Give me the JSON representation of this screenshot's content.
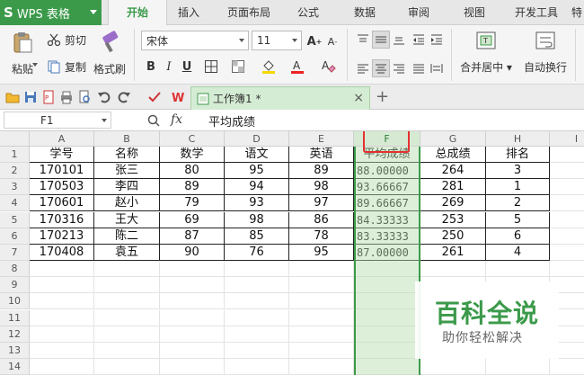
{
  "app": {
    "name": "WPS 表格"
  },
  "menu_tabs": [
    "开始",
    "插入",
    "页面布局",
    "公式",
    "数据",
    "审阅",
    "视图",
    "开发工具",
    "特"
  ],
  "ribbon": {
    "paste_label": "粘贴",
    "cut_label": "剪切",
    "copy_label": "复制",
    "format_painter_label": "格式刷",
    "font_name": "宋体",
    "font_size": "11",
    "bold": "B",
    "italic": "I",
    "underline": "U",
    "grow_font": "A",
    "shrink_font": "A",
    "merge_center_label": "合并居中",
    "wrap_text_label": "自动换行"
  },
  "document": {
    "tab_title": "工作簿1 *"
  },
  "formula_bar": {
    "cell_ref": "F1",
    "fx": "fx",
    "value": "平均成绩"
  },
  "columns": [
    "A",
    "B",
    "C",
    "D",
    "E",
    "F",
    "G",
    "H",
    "I"
  ],
  "rows": [
    "1",
    "2",
    "3",
    "4",
    "5",
    "6",
    "7",
    "8",
    "9",
    "10",
    "11",
    "12",
    "13",
    "14"
  ],
  "table": {
    "headers": [
      "学号",
      "名称",
      "数学",
      "语文",
      "英语",
      "平均成绩",
      "总成绩",
      "排名"
    ],
    "records": [
      [
        "170101",
        "张三",
        "80",
        "95",
        "89",
        "88.00000",
        "264",
        "3"
      ],
      [
        "170503",
        "李四",
        "89",
        "94",
        "98",
        "93.66667",
        "281",
        "1"
      ],
      [
        "170601",
        "赵小",
        "79",
        "93",
        "97",
        "89.66667",
        "269",
        "2"
      ],
      [
        "170316",
        "王大",
        "69",
        "98",
        "86",
        "84.33333",
        "253",
        "5"
      ],
      [
        "170213",
        "陈二",
        "87",
        "85",
        "78",
        "83.33333",
        "250",
        "6"
      ],
      [
        "170408",
        "袁五",
        "90",
        "76",
        "95",
        "87.00000",
        "261",
        "4"
      ]
    ]
  },
  "watermark": {
    "title": "百科全说",
    "subtitle": "助你轻松解决"
  },
  "colors": {
    "accent": "#3b9a4a",
    "highlight": "#e53030"
  }
}
